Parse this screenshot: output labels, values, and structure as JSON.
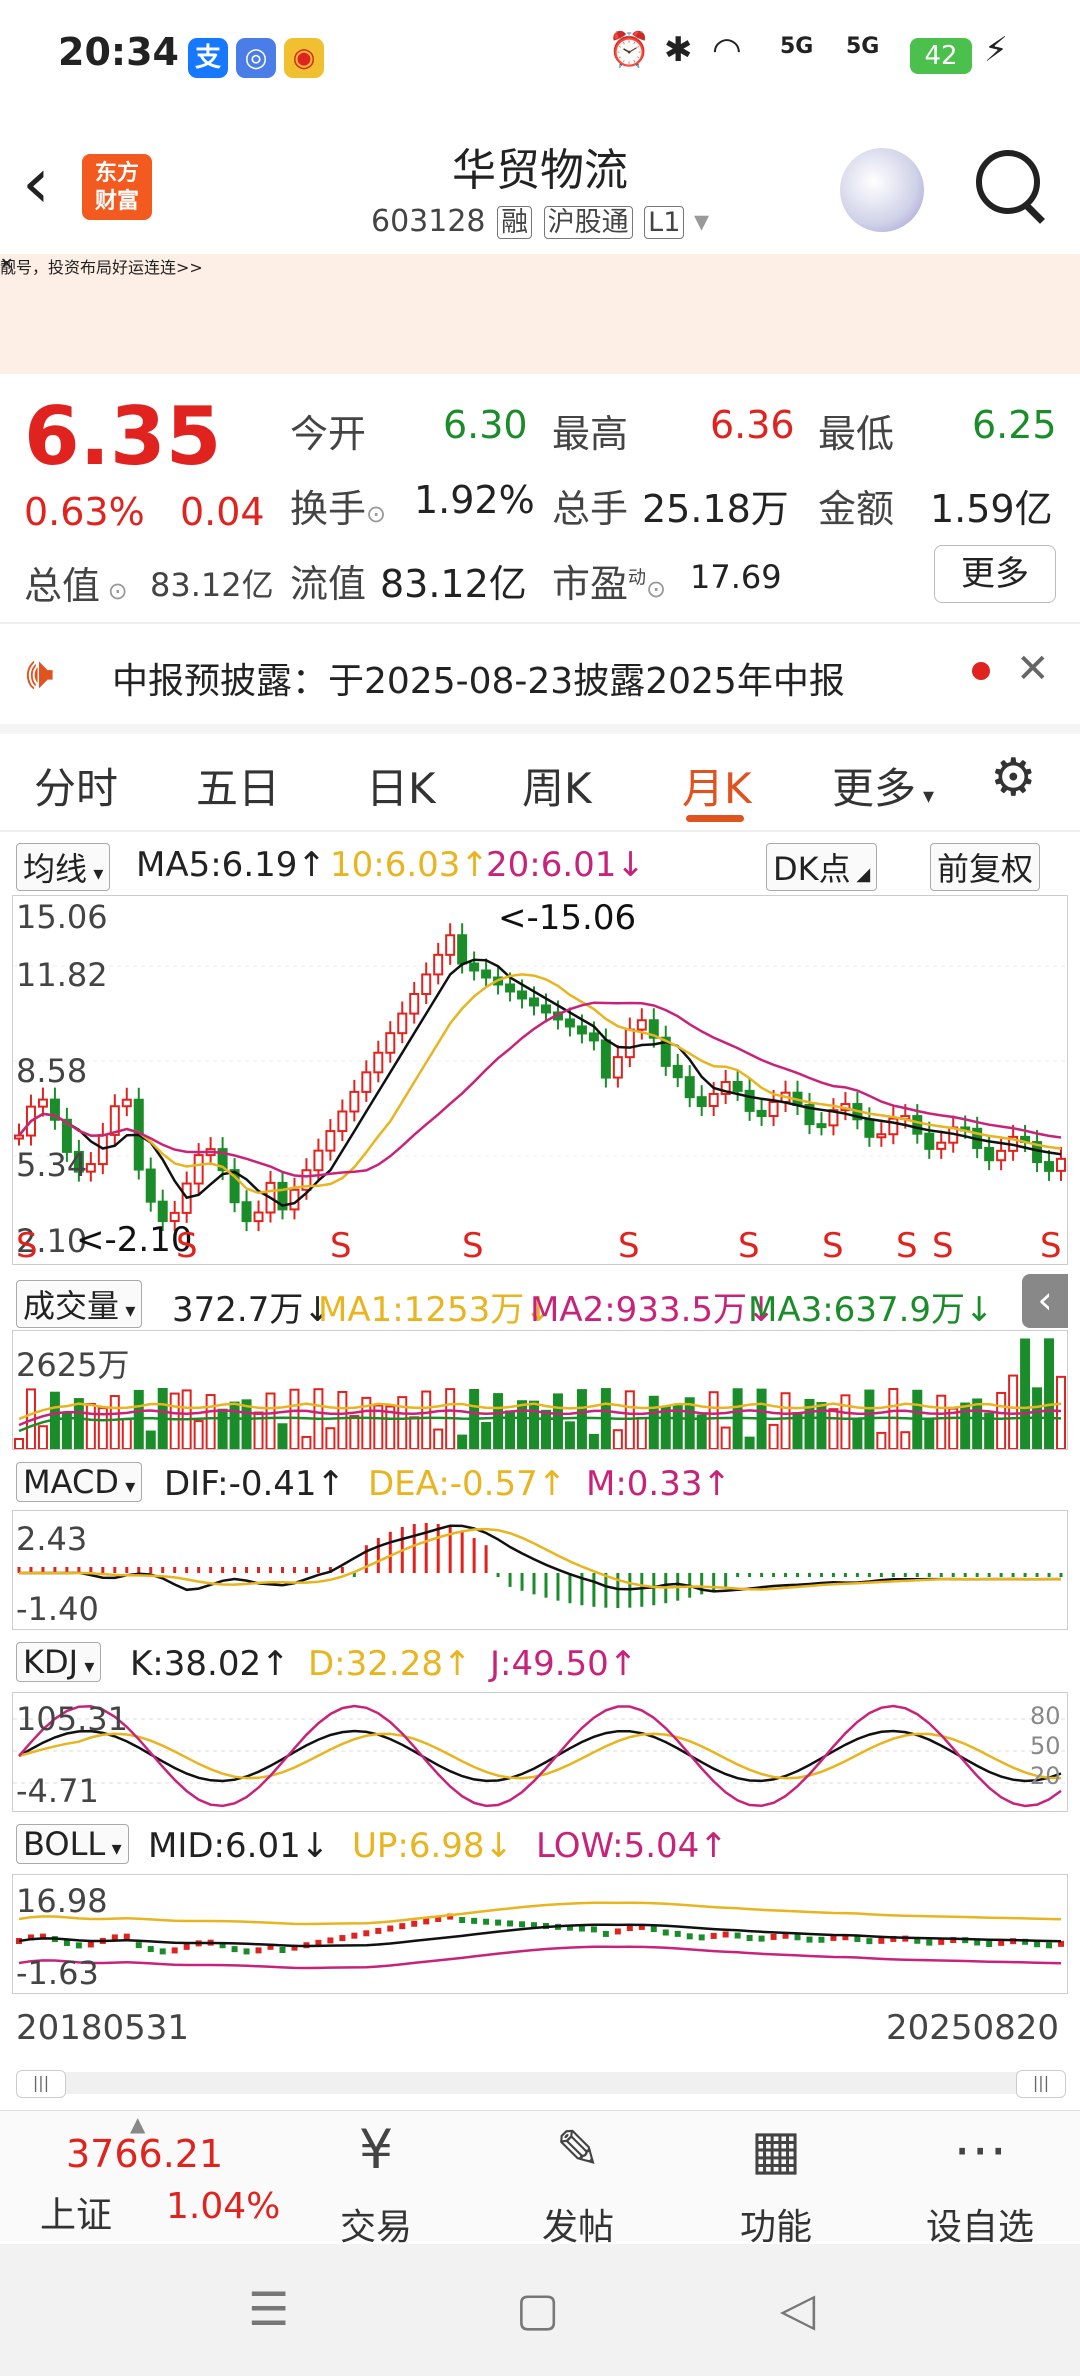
{
  "status": {
    "time": "20:34",
    "battery": "42",
    "icon_alipay": "支",
    "signal_5g": "5G"
  },
  "header": {
    "name": "华贸物流",
    "code": "603128",
    "tag_rong": "融",
    "tag_hgt": "沪股通",
    "tag_l1": "L1",
    "logo_line1": "东方",
    "logo_line2": "财富"
  },
  "banner": {
    "text": "靓号，投资布局好运连连>>",
    "close": "✕"
  },
  "quote": {
    "price": "6.35",
    "pct": "0.63%",
    "chg": "0.04",
    "open_label": "今开",
    "open": "6.30",
    "high_label": "最高",
    "high": "6.36",
    "low_label": "最低",
    "low": "6.25",
    "turnover_label": "换手",
    "turnover": "1.92%",
    "vol_label": "总手",
    "vol": "25.18万",
    "amount_label": "金额",
    "amount": "1.59亿",
    "mcap_label": "总值",
    "mcap": "83.12亿",
    "float_label": "流值",
    "float": "83.12亿",
    "pe_label": "市盈",
    "pe_sup": "动",
    "pe": "17.69",
    "more": "更多"
  },
  "notice": {
    "text": "中报预披露：于2025-08-23披露2025年中报",
    "close": "✕"
  },
  "tabs": [
    "分时",
    "五日",
    "日K",
    "周K",
    "月K",
    "更多"
  ],
  "indicators": {
    "ma": {
      "label": "均线",
      "ma5": "MA5:6.19↑",
      "ma10": "10:6.03↑",
      "ma20": "20:6.01↓",
      "dk": "DK点",
      "fq": "前复权"
    },
    "main_axis": [
      "15.06",
      "11.82",
      "8.58",
      "5.34",
      "2.10"
    ],
    "main_marks": {
      "high": "<-15.06",
      "low": "<-2.10",
      "s": "S"
    },
    "volume": {
      "label": "成交量",
      "val": "372.7万↓",
      "ma1": "MA1:1253万↓",
      "ma2": "MA2:933.5万↓",
      "ma3": "MA3:637.9万↓",
      "axis": "2625万"
    },
    "macd": {
      "label": "MACD",
      "dif": "DIF:-0.41↑",
      "dea": "DEA:-0.57↑",
      "m": "M:0.33↑",
      "axis_top": "2.43",
      "axis_bot": "-1.40"
    },
    "kdj": {
      "label": "KDJ",
      "k": "K:38.02↑",
      "d": "D:32.28↑",
      "j": "J:49.50↑",
      "axis_top": "105.31",
      "axis_bot": "-4.71",
      "r80": "80",
      "r50": "50",
      "r20": "20"
    },
    "boll": {
      "label": "BOLL",
      "mid": "MID:6.01↓",
      "up": "UP:6.98↓",
      "low": "LOW:5.04↑",
      "axis_top": "16.98",
      "axis_bot": "-1.63"
    }
  },
  "dates": {
    "start": "20180531",
    "end": "20250820"
  },
  "bottom": {
    "index_value": "3766.21",
    "index_name": "上证",
    "index_pct": "1.04%",
    "items": [
      "交易",
      "发帖",
      "功能",
      "设自选"
    ]
  },
  "colors": {
    "up": "#e0231f",
    "down": "#1a8d2a",
    "ma10": "#e8b41f",
    "ma20": "#c8237a",
    "accent": "#e0531f"
  }
}
